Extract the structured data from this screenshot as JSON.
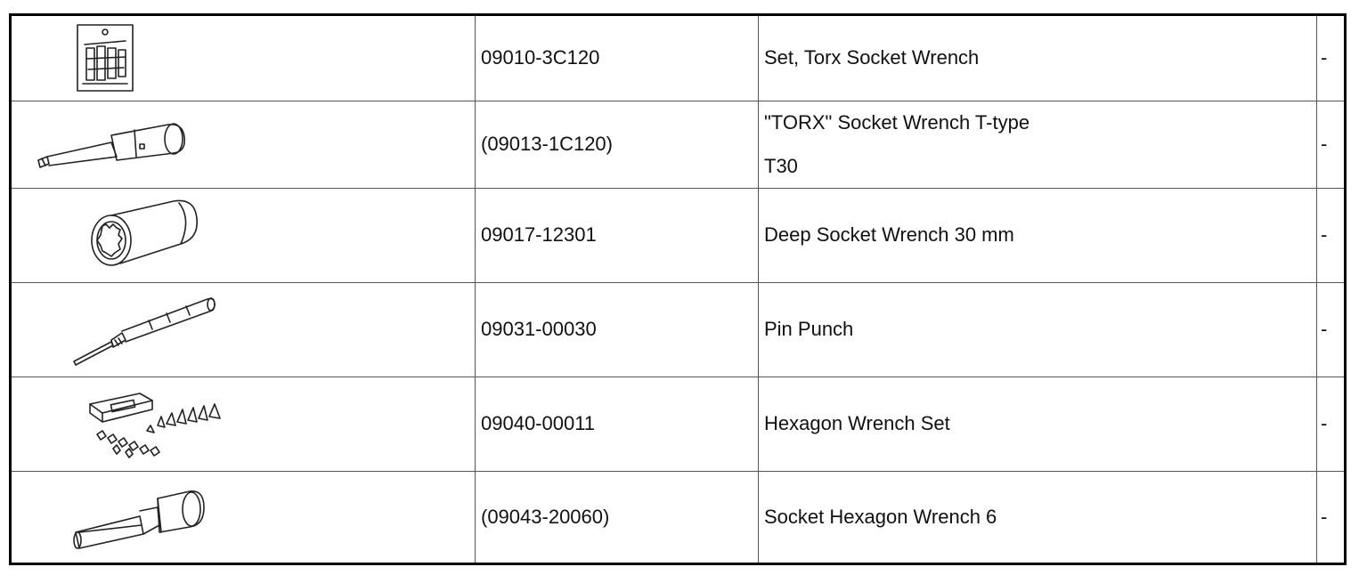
{
  "rows": [
    {
      "illustration": "torx-socket-set-icon",
      "part_no": "09010-3C120",
      "name": "Set, Torx Socket Wrench",
      "note": "-"
    },
    {
      "illustration": "torx-socket-t-type-icon",
      "part_no": "(09013-1C120)",
      "name": "\"TORX\" Socket Wrench T-type",
      "name_line2": "T30",
      "note": "-"
    },
    {
      "illustration": "deep-socket-icon",
      "part_no": "09017-12301",
      "name": "Deep Socket Wrench 30 mm",
      "note": "-"
    },
    {
      "illustration": "pin-punch-icon",
      "part_no": "09031-00030",
      "name": "Pin Punch",
      "note": "-"
    },
    {
      "illustration": "hexagon-wrench-set-icon",
      "part_no": "09040-00011",
      "name": "Hexagon Wrench Set",
      "note": "-"
    },
    {
      "illustration": "socket-hexagon-wrench-icon",
      "part_no": "(09043-20060)",
      "name": "Socket Hexagon Wrench 6",
      "note": "-"
    }
  ]
}
